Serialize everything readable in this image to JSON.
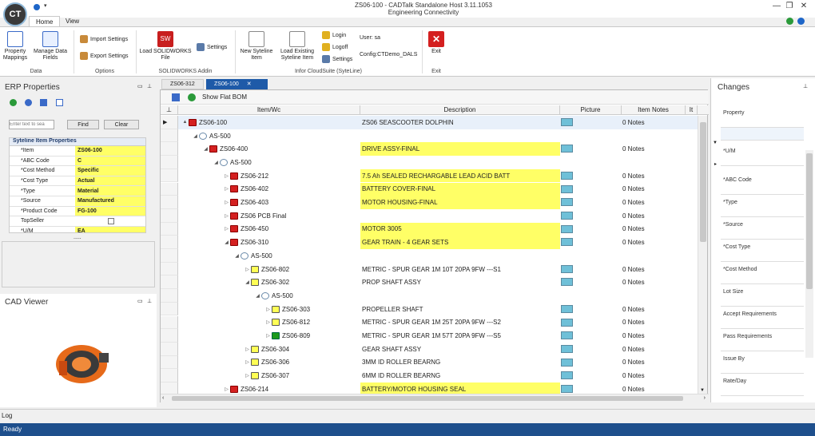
{
  "window": {
    "title_line1": "ZS06-100 - CADTalk Standalone Host 3.11.1053",
    "title_line2": "Engineering Connectivity",
    "logo_text": "CT"
  },
  "ribbon_tabs": [
    "Home",
    "View"
  ],
  "ribbon": {
    "property_mappings": "Property Mappings",
    "manage_data_fields": "Manage Data Fields",
    "group_data": "Data",
    "import_settings": "Import Settings",
    "export_settings": "Export Settings",
    "group_options": "Options",
    "load_solidworks_file": "Load SOLIDWORKS File",
    "settings_sw": "Settings",
    "group_sw": "SOLIDWORKS Addin",
    "new_syteline_item": "New Syteline Item",
    "load_existing_syteline_item": "Load Existing Syteline Item",
    "login": "Login",
    "logoff": "Logoff",
    "settings_cs": "Settings",
    "user": "User: sa",
    "config": "Config:CTDemo_DALS",
    "group_cs": "Infor CloudSuite (SyteLine)",
    "exit": "Exit",
    "group_exit": "Exit"
  },
  "erp_panel": {
    "title": "ERP Properties",
    "filter_placeholder": "Enter text to sea",
    "find": "Find",
    "clear": "Clear",
    "section_title": "Syteline Item Properties",
    "properties": [
      {
        "name": "*Item",
        "value": "ZS06-100"
      },
      {
        "name": "*ABC Code",
        "value": "C"
      },
      {
        "name": "*Cost Method",
        "value": "Specific"
      },
      {
        "name": "*Cost Type",
        "value": "Actual"
      },
      {
        "name": "*Type",
        "value": "Material"
      },
      {
        "name": "*Source",
        "value": "Manufactured"
      },
      {
        "name": "*Product Code",
        "value": "FG-100"
      },
      {
        "name": "TopSeller",
        "value": ""
      },
      {
        "name": "*U/M",
        "value": "EA"
      }
    ],
    "more": "....."
  },
  "cad_panel": {
    "title": "CAD Viewer"
  },
  "doc_tabs": [
    {
      "label": "ZS06-312",
      "active": false
    },
    {
      "label": "ZS06-100",
      "active": true
    }
  ],
  "grid_toolbar": {
    "show_flat_bom": "Show Flat BOM"
  },
  "grid_headers": {
    "item": "Item/Wc",
    "description": "Description",
    "picture": "Picture",
    "item_notes": "Item Notes",
    "it": "It"
  },
  "bom_rows": [
    {
      "indent": 0,
      "toggle": "▲",
      "icon": "red-as",
      "item": "ZS06-100",
      "desc": "ZS06 SEASCOOTER  DOLPHIN",
      "hl": false,
      "pic": true,
      "notes": "0 Notes",
      "selected": true
    },
    {
      "indent": 1,
      "toggle": "◢",
      "icon": "as",
      "item": "AS-500",
      "desc": "",
      "hl": false,
      "pic": false,
      "notes": ""
    },
    {
      "indent": 2,
      "toggle": "◢",
      "icon": "red-as",
      "item": "ZS06-400",
      "desc": "DRIVE ASSY-FINAL",
      "hl": true,
      "pic": true,
      "notes": "0 Notes"
    },
    {
      "indent": 3,
      "toggle": "◢",
      "icon": "as",
      "item": "AS-500",
      "desc": "",
      "hl": false,
      "pic": false,
      "notes": ""
    },
    {
      "indent": 4,
      "toggle": "▷",
      "icon": "red",
      "item": "ZS06-212",
      "desc": "7.5 Ah SEALED RECHARGABLE LEAD ACID BATT",
      "hl": true,
      "pic": true,
      "notes": "0 Notes"
    },
    {
      "indent": 4,
      "toggle": "▷",
      "icon": "red",
      "item": "ZS06-402",
      "desc": "BATTERY COVER-FINAL",
      "hl": true,
      "pic": true,
      "notes": "0 Notes"
    },
    {
      "indent": 4,
      "toggle": "▷",
      "icon": "red",
      "item": "ZS06-403",
      "desc": "MOTOR HOUSING-FINAL",
      "hl": true,
      "pic": true,
      "notes": "0 Notes"
    },
    {
      "indent": 4,
      "toggle": "▷",
      "icon": "red",
      "item": "ZS06 PCB Final",
      "desc": "",
      "hl": false,
      "pic": true,
      "notes": "0 Notes"
    },
    {
      "indent": 4,
      "toggle": "▷",
      "icon": "red",
      "item": "ZS06-450",
      "desc": "MOTOR 3005",
      "hl": true,
      "pic": true,
      "notes": "0 Notes"
    },
    {
      "indent": 4,
      "toggle": "◢",
      "icon": "red-as",
      "item": "ZS06-310",
      "desc": "GEAR TRAIN - 4 GEAR SETS",
      "hl": true,
      "pic": true,
      "notes": "0 Notes"
    },
    {
      "indent": 5,
      "toggle": "◢",
      "icon": "as",
      "item": "AS-500",
      "desc": "",
      "hl": false,
      "pic": false,
      "notes": ""
    },
    {
      "indent": 6,
      "toggle": "▷",
      "icon": "yel",
      "item": "ZS06-802",
      "desc": "METRIC - SPUR GEAR 1M 10T 20PA 9FW ---S1",
      "hl": false,
      "pic": true,
      "notes": "0 Notes"
    },
    {
      "indent": 6,
      "toggle": "◢",
      "icon": "yel-as",
      "item": "ZS06-302",
      "desc": "PROP SHAFT ASSY",
      "hl": false,
      "pic": true,
      "notes": "0 Notes"
    },
    {
      "indent": 7,
      "toggle": "◢",
      "icon": "as",
      "item": "AS-500",
      "desc": "",
      "hl": false,
      "pic": false,
      "notes": ""
    },
    {
      "indent": 8,
      "toggle": "▷",
      "icon": "yel",
      "item": "ZS06-303",
      "desc": "PROPELLER SHAFT",
      "hl": false,
      "pic": true,
      "notes": "0 Notes"
    },
    {
      "indent": 8,
      "toggle": "▷",
      "icon": "yel",
      "item": "ZS06-812",
      "desc": "METRIC - SPUR GEAR 1M 25T 20PA 9FW ---S2",
      "hl": false,
      "pic": true,
      "notes": "0 Notes"
    },
    {
      "indent": 8,
      "toggle": "▷",
      "icon": "grn",
      "item": "ZS06-809",
      "desc": "METRIC - SPUR GEAR 1M 57T 20PA 9FW ---S5",
      "hl": false,
      "pic": true,
      "notes": "0 Notes"
    },
    {
      "indent": 6,
      "toggle": "▷",
      "icon": "yel-as",
      "item": "ZS06-304",
      "desc": "GEAR SHAFT ASSY",
      "hl": false,
      "pic": true,
      "notes": "0 Notes"
    },
    {
      "indent": 6,
      "toggle": "▷",
      "icon": "yel",
      "item": "ZS06-306",
      "desc": "3MM ID ROLLER BEARNG",
      "hl": false,
      "pic": true,
      "notes": "0 Notes"
    },
    {
      "indent": 6,
      "toggle": "▷",
      "icon": "yel",
      "item": "ZS06-307",
      "desc": "6MM ID ROLLER BEARNG",
      "hl": false,
      "pic": true,
      "notes": "0 Notes"
    },
    {
      "indent": 4,
      "toggle": "▷",
      "icon": "red",
      "item": "ZS06-214",
      "desc": "BATTERY/MOTOR HOUSING SEAL",
      "hl": true,
      "pic": true,
      "notes": "0 Notes"
    }
  ],
  "changes_panel": {
    "title": "Changes",
    "rows": [
      "Property",
      "",
      "*U/M",
      "*ABC Code",
      "*Type",
      "*Source",
      "*Cost Type",
      "*Cost Method",
      "Lot Size",
      "Accept Requirements",
      "Pass Requirements",
      "Issue By",
      "Rate/Day"
    ]
  },
  "log_tab": "Log",
  "status": "Ready"
}
